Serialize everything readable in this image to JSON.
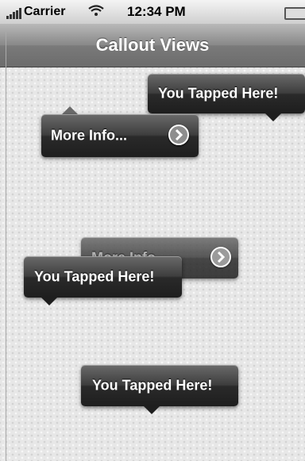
{
  "status_bar": {
    "carrier": "Carrier",
    "time": "12:34 PM"
  },
  "nav_bar": {
    "title": "Callout Views"
  },
  "callouts": [
    {
      "label": "You Tapped Here!"
    },
    {
      "label": "More Info..."
    },
    {
      "label": "More Info..."
    },
    {
      "label": "You Tapped Here!"
    },
    {
      "label": "You Tapped Here!"
    }
  ],
  "icons": {
    "disclosure": "chevron-right-circle-icon",
    "signal": "signal-bars-icon",
    "wifi": "wifi-icon",
    "battery": "battery-icon"
  }
}
